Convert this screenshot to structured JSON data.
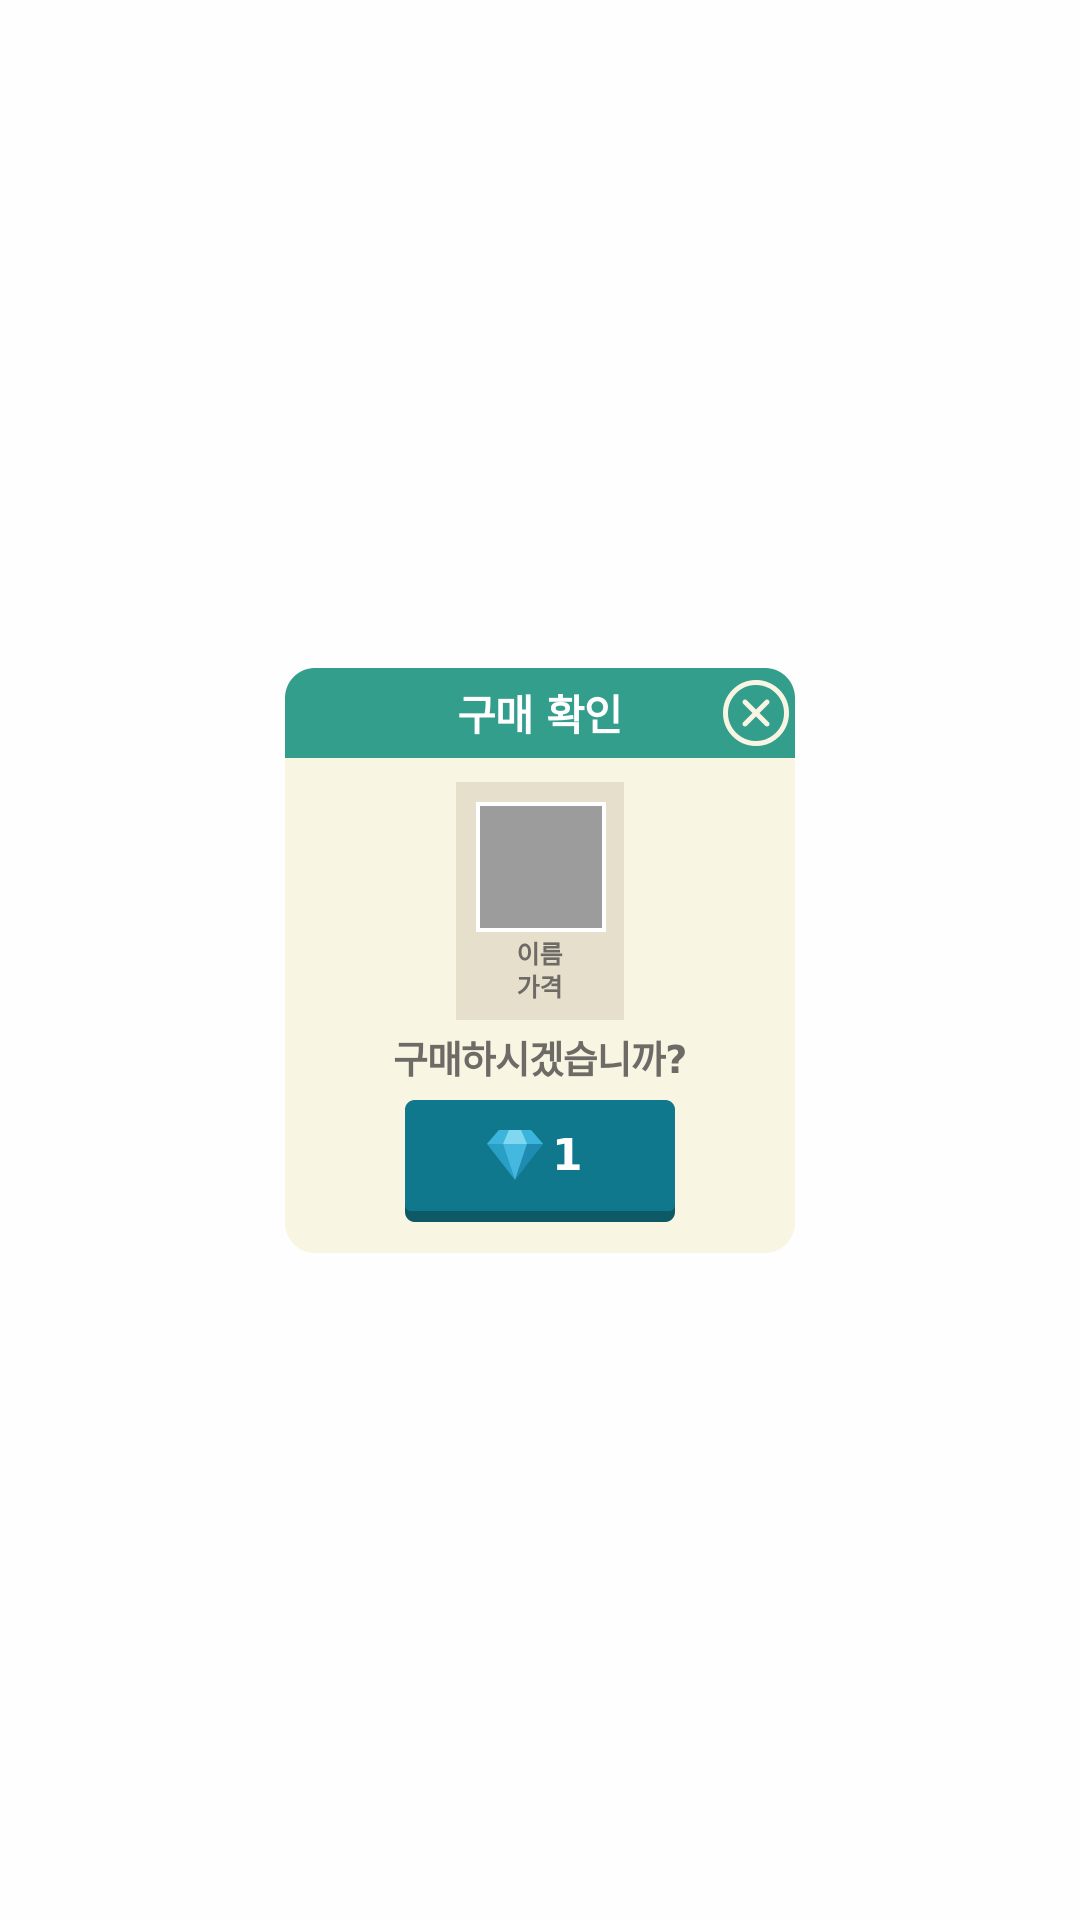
{
  "dialog": {
    "title": "구매 확인",
    "close_icon": "close-circle-icon",
    "item": {
      "name": "이름",
      "price": "가격"
    },
    "question": "구매하시겠습니까?",
    "buy_button": {
      "currency_icon": "diamond-gem-icon",
      "amount": "1"
    }
  },
  "colors": {
    "header": "#339e8c",
    "dialog_background": "#f8f5e3",
    "item_card": "#e6dfcc",
    "button": "#0f788c",
    "button_shadow": "#0d5966",
    "text": "#6e6a66"
  }
}
